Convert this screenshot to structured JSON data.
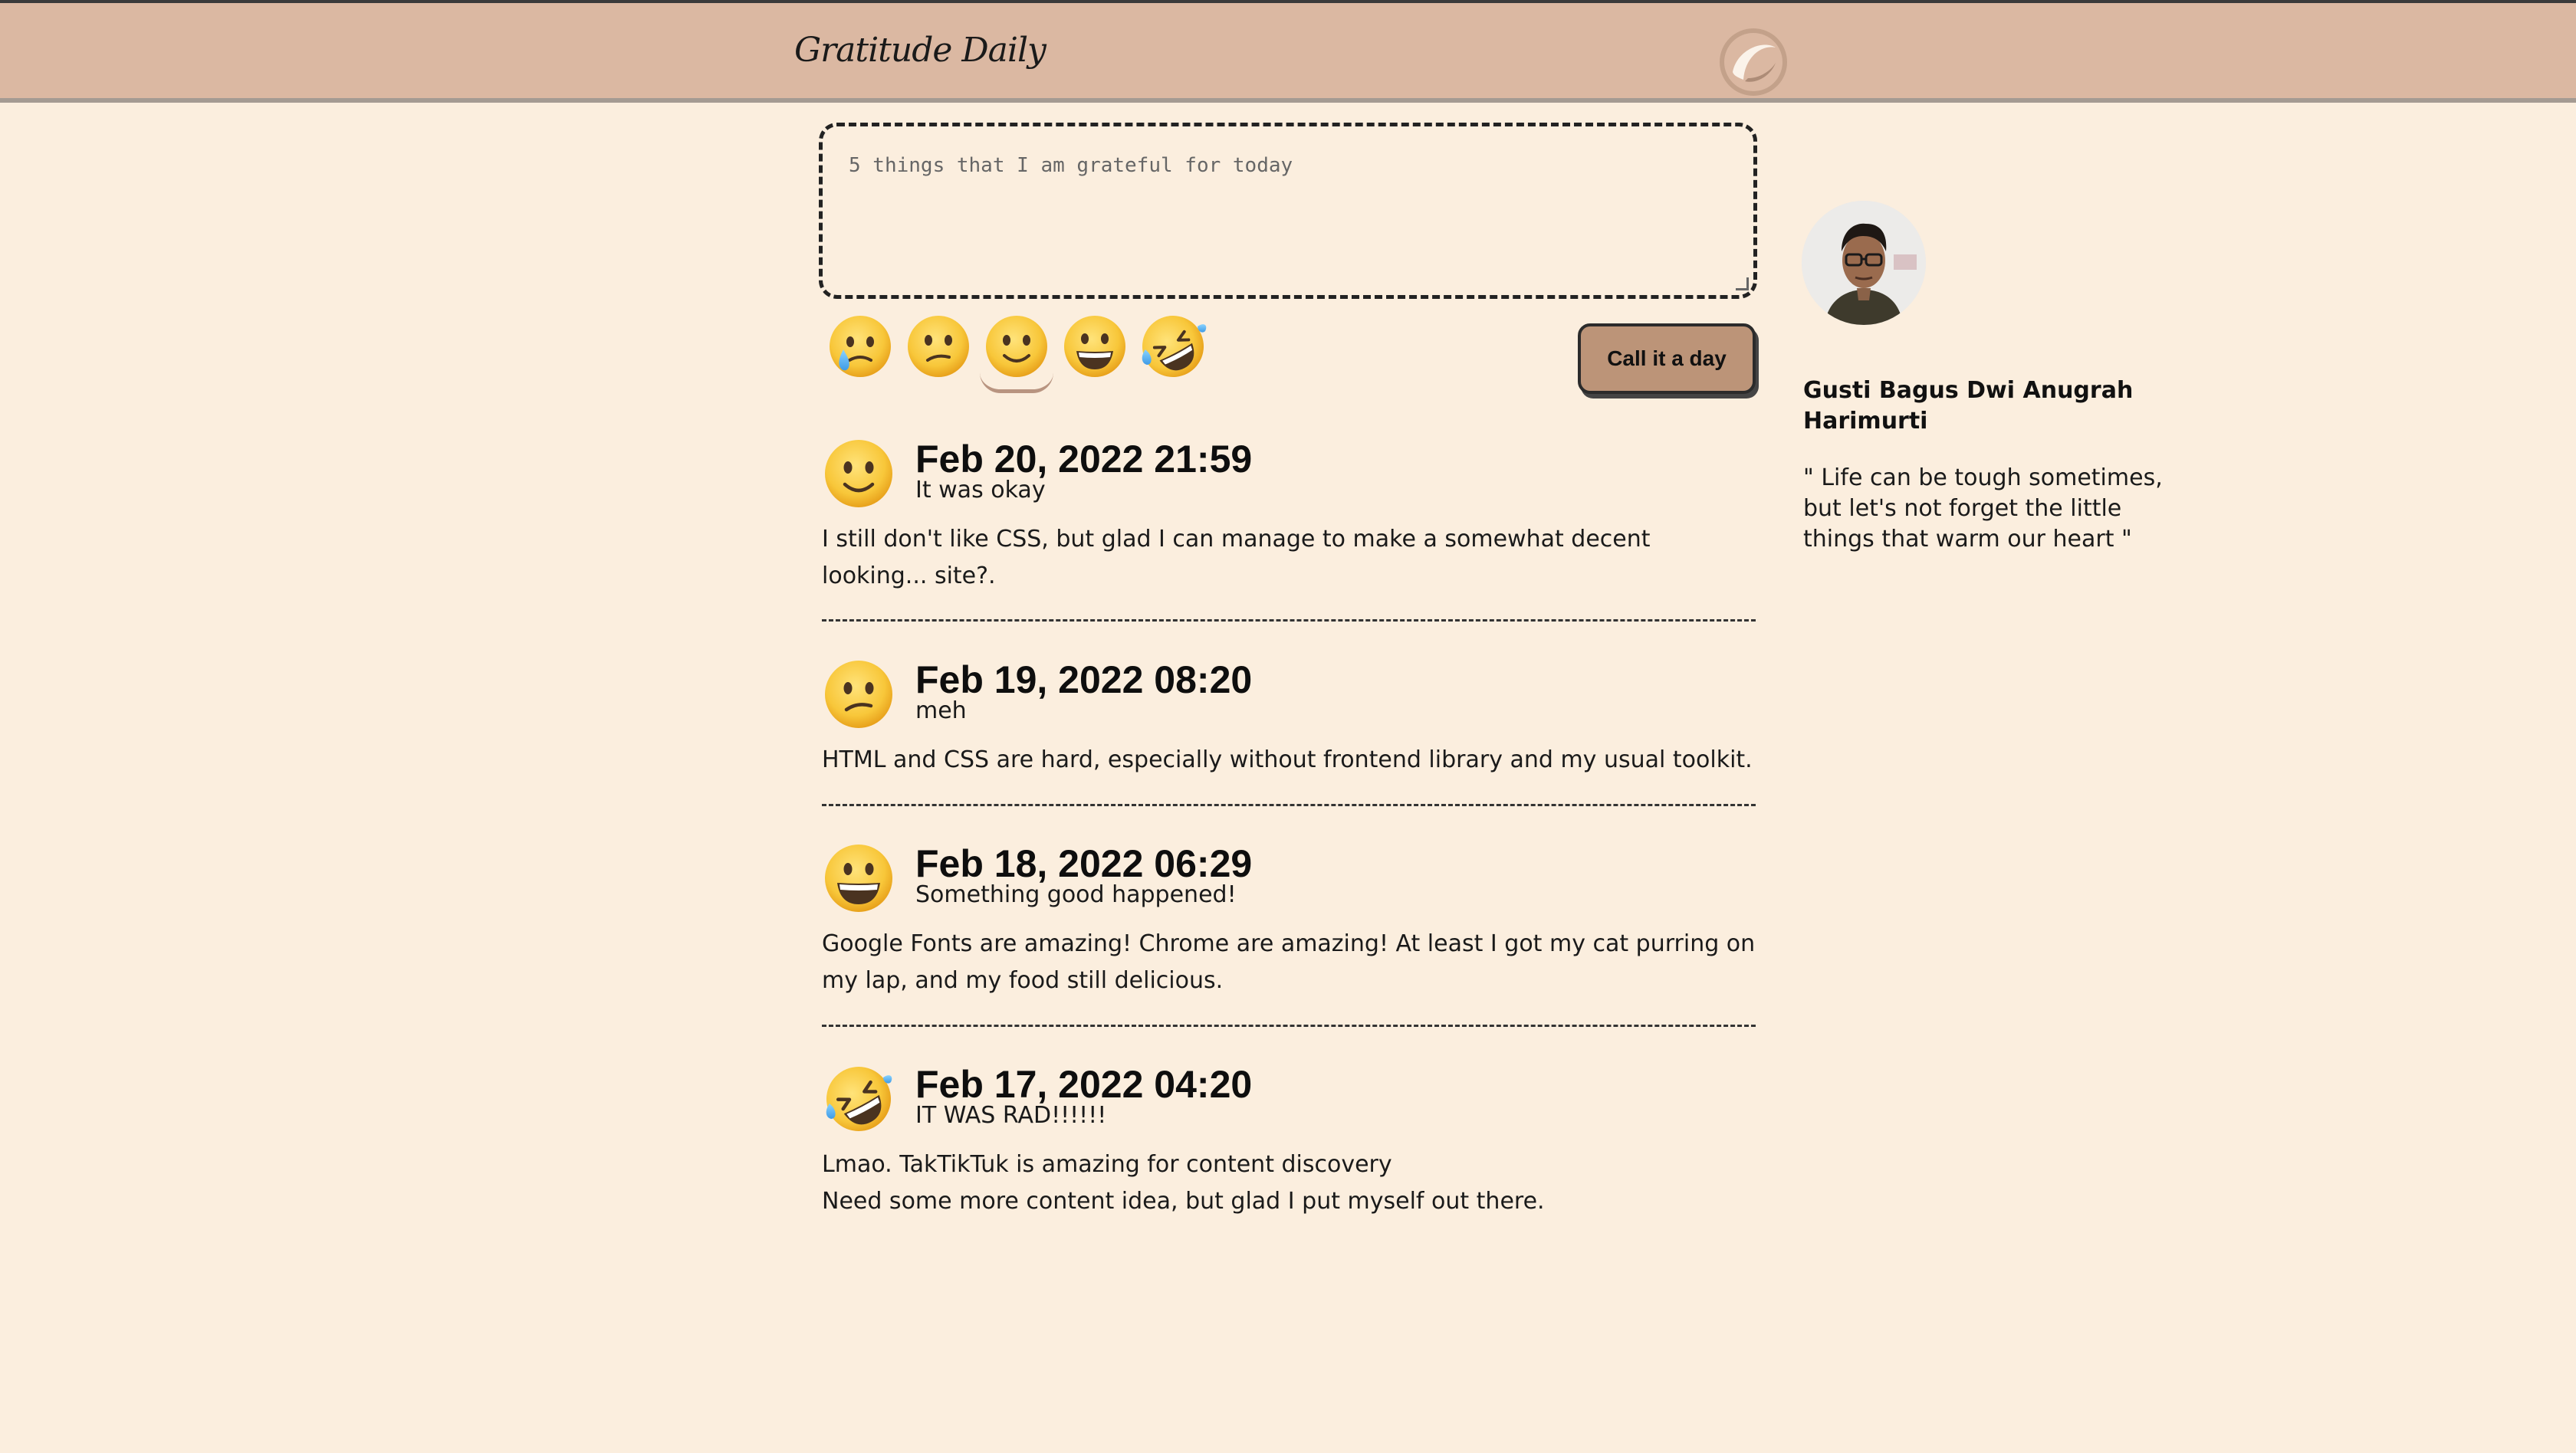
{
  "app": {
    "logo_text": "Gratitude Daily",
    "colors": {
      "header_bg": "#dbb8a2",
      "page_bg": "#fbeede",
      "button_bg": "#bc9478",
      "accent_underline": "#b89480"
    },
    "theme_toggle_icon": "crescent-moon-icon"
  },
  "composer": {
    "placeholder": "5 things that I am grateful for today",
    "value": "",
    "moods": [
      {
        "name": "crying-face",
        "selected": false
      },
      {
        "name": "confused-face",
        "selected": false
      },
      {
        "name": "slightly-smiling-face",
        "selected": true
      },
      {
        "name": "grinning-face",
        "selected": false
      },
      {
        "name": "rolling-on-floor-laughing-face",
        "selected": false
      }
    ],
    "submit_label": "Call it a day"
  },
  "entries": [
    {
      "mood_icon": "slightly-smiling-face",
      "date": "Feb 20, 2022 21:59",
      "mood_text": "It was okay",
      "body": "I still don't like CSS, but glad I can manage to make a somewhat decent looking... site?."
    },
    {
      "mood_icon": "confused-face",
      "date": "Feb 19, 2022 08:20",
      "mood_text": "meh",
      "body": "HTML and CSS are hard, especially without frontend library and my usual toolkit."
    },
    {
      "mood_icon": "grinning-face",
      "date": "Feb 18, 2022 06:29",
      "mood_text": "Something good happened!",
      "body": "Google Fonts are amazing! Chrome are amazing! At least I got my cat purring on my lap, and my food still delicious."
    },
    {
      "mood_icon": "rolling-on-floor-laughing-face",
      "date": "Feb 17, 2022 04:20",
      "mood_text": "IT WAS RAD!!!!!!",
      "body": "Lmao. TakTikTuk is amazing for content discovery\nNeed some more content idea, but glad I put myself out there."
    }
  ],
  "profile": {
    "name": "Gusti Bagus Dwi Anugrah Harimurti",
    "quote": "\" Life can be tough sometimes, but let's not forget the little things that warm our heart \""
  }
}
